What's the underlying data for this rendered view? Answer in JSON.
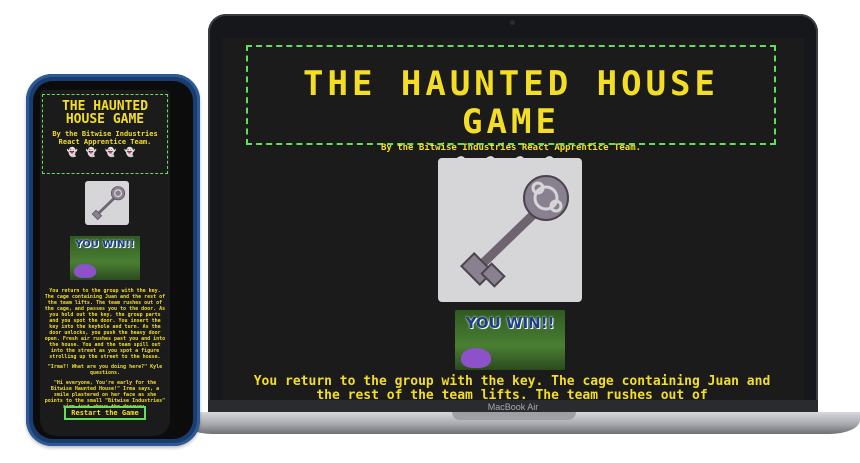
{
  "game": {
    "title": "THE HAUNTED HOUSE GAME",
    "title_mobile": "THE HAUNTED HOUSE GAME",
    "subtitle": "By the Bitwise Industries React Apprentice Team.",
    "ghost_icon": "ghost-icon",
    "ghost_count": 4,
    "key_image": "skeleton-key-image",
    "win_banner": "YOU WIN!!",
    "story_desktop": "You return to the group with the key. The cage containing Juan and the rest of the team lifts. The team rushes out of",
    "story_mobile": [
      "You return to the group with the key. The cage containing Juan and the rest of the team lifts. The team rushes out of the cage, and passes you to the door. As you hold out the key, the group parts and you spot the door. You insert the key into the keyhole and turn. As the door unlocks, you push the heavy door open. Fresh air rushes past you and into the house. You and the team spill out into the street as you spot a figure strolling up the street to the house.",
      "\"Irma?! What are you doing here?\" Kyle questions.",
      "\"Hi everyone, You're early for the Bitwise Haunted House!\" Irma says, a smile plastered on her face as she points to the small \"Bitwise Industries\" sign just above the doorway."
    ],
    "restart_label": "Restart the Game"
  },
  "device": {
    "laptop_label": "MacBook Air"
  },
  "colors": {
    "accent_yellow": "#f3dd25",
    "border_green": "#5fe05a",
    "background": "#1b1b1b"
  }
}
